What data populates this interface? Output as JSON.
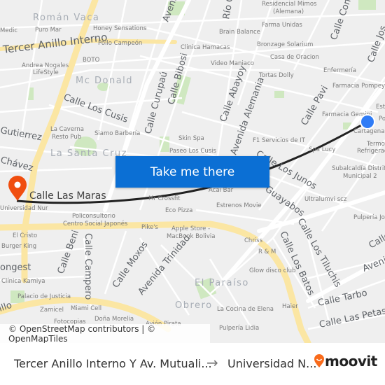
{
  "map": {
    "streets": [
      "Tercer Anillo Interno",
      "Calle Los Cusis",
      "Calle Curupaú",
      "Calle Bibosi",
      "Calle Abayoy",
      "Avenida Alemania",
      "Calle Pavi",
      "Calle Com",
      "Calle Jos",
      "Río G",
      "Avenida",
      "Gutierrez",
      "Chávez",
      "Calle Las Maras",
      "Calle Los Junos",
      "Guayabos",
      "Calle Los Tiluchis",
      "Calle Los Batos",
      "Calle Tarbo",
      "Calle Las Petas",
      "Calle Beni",
      "Calle Campero",
      "Calle Moxos",
      "Avenida Trinidad",
      "Aveni",
      "Calle",
      "ongest",
      "illo"
    ],
    "neighborhoods": [
      "Román Vaca",
      "Mc Donald",
      "La Santa Cruz",
      "El Paraíso",
      "Obrero"
    ],
    "pois": [
      "Puro Mar",
      "Honey Sensations",
      "Pollo Campeón",
      "BOTO",
      "Andrea Nogales",
      "LifeStyle",
      "Clinica Hamacas",
      "Video Maniaco",
      "Brain Balance",
      "Residencial Mimos",
      "(Alemana)",
      "Farma Unidas",
      "Bronzage Solarium",
      "Casa de Oracion",
      "Tortas Dolly",
      "Enfermería",
      "Farmacia Pompeya",
      "Farmacia Gemini",
      "Cartagena",
      "Termo",
      "Refrigerac",
      "Skin Spa",
      "Paseo Los Cusis",
      "F1 Servicios de IT",
      "Spa Lucy",
      "Subalcaldía Distrito",
      "Municipal 2",
      "La Caverna",
      "Resto Pub",
      "Siamo Barbería",
      "Ultralumvi scz",
      "Pulpería Jos",
      "Acai Bar",
      "Estrenos Movie",
      "Mr Crossfit",
      "Eco Pizza",
      "Policonsultorio",
      "Centro Social Japonés",
      "Pike's",
      "Apple Store -",
      "MacBook Bolivia",
      "Chriss",
      "R & M",
      "Glow disco club",
      "El Cristo",
      "Burger King",
      "Clínica Kamiya",
      "Palacio de Justicia",
      "Zamicel",
      "Miami Cell",
      "Doña Morelia",
      "Fotocopias",
      "La Cocina de Elena",
      "Haier",
      "Pulpería Lidia",
      "Universidad Nur",
      "Medic",
      "Est",
      "Po",
      "Avión Pirata"
    ],
    "colors": {
      "route": "#222222",
      "origin": "#2f7cf6",
      "destination": "#f04e0f",
      "major_road": "#fbe6a3",
      "park": "#cfe8c0"
    }
  },
  "button": {
    "label": "Take me there"
  },
  "attribution": "© OpenStreetMap contributors | © OpenMapTiles",
  "footer": {
    "from": "Tercer Anillo Interno Y Av. Mutuali...",
    "arrow": "→",
    "to": "Universidad N...",
    "brand": "moovit",
    "brand_color": "#f96b1b"
  }
}
